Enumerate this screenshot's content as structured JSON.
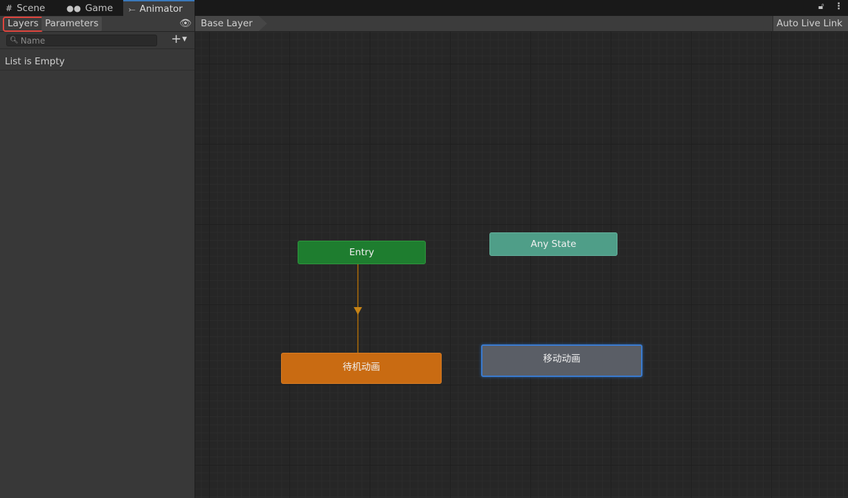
{
  "tabs": [
    {
      "label": "Scene",
      "icon": "grid-icon"
    },
    {
      "label": "Game",
      "icon": "gamepad-icon"
    },
    {
      "label": "Animator",
      "icon": "animator-icon"
    }
  ],
  "left_panel": {
    "tabs": {
      "layers": "Layers",
      "parameters": "Parameters"
    },
    "search": {
      "placeholder": "Name",
      "value": ""
    },
    "empty_message": "List is Empty"
  },
  "breadcrumb": {
    "layer": "Base Layer"
  },
  "toolbar": {
    "auto_live_link": "Auto Live Link"
  },
  "graph": {
    "states": {
      "entry": "Entry",
      "any_state": "Any State",
      "idle": "待机动画",
      "move": "移动动画"
    }
  },
  "colors": {
    "entry": "#1e7d2f",
    "any_state": "#4f9e88",
    "default_state": "#c96b12",
    "selected_state": "#5a5e66",
    "selection_outline": "#3a7bd0",
    "transition": "#8a5a10",
    "highlight": "#e0453d"
  }
}
